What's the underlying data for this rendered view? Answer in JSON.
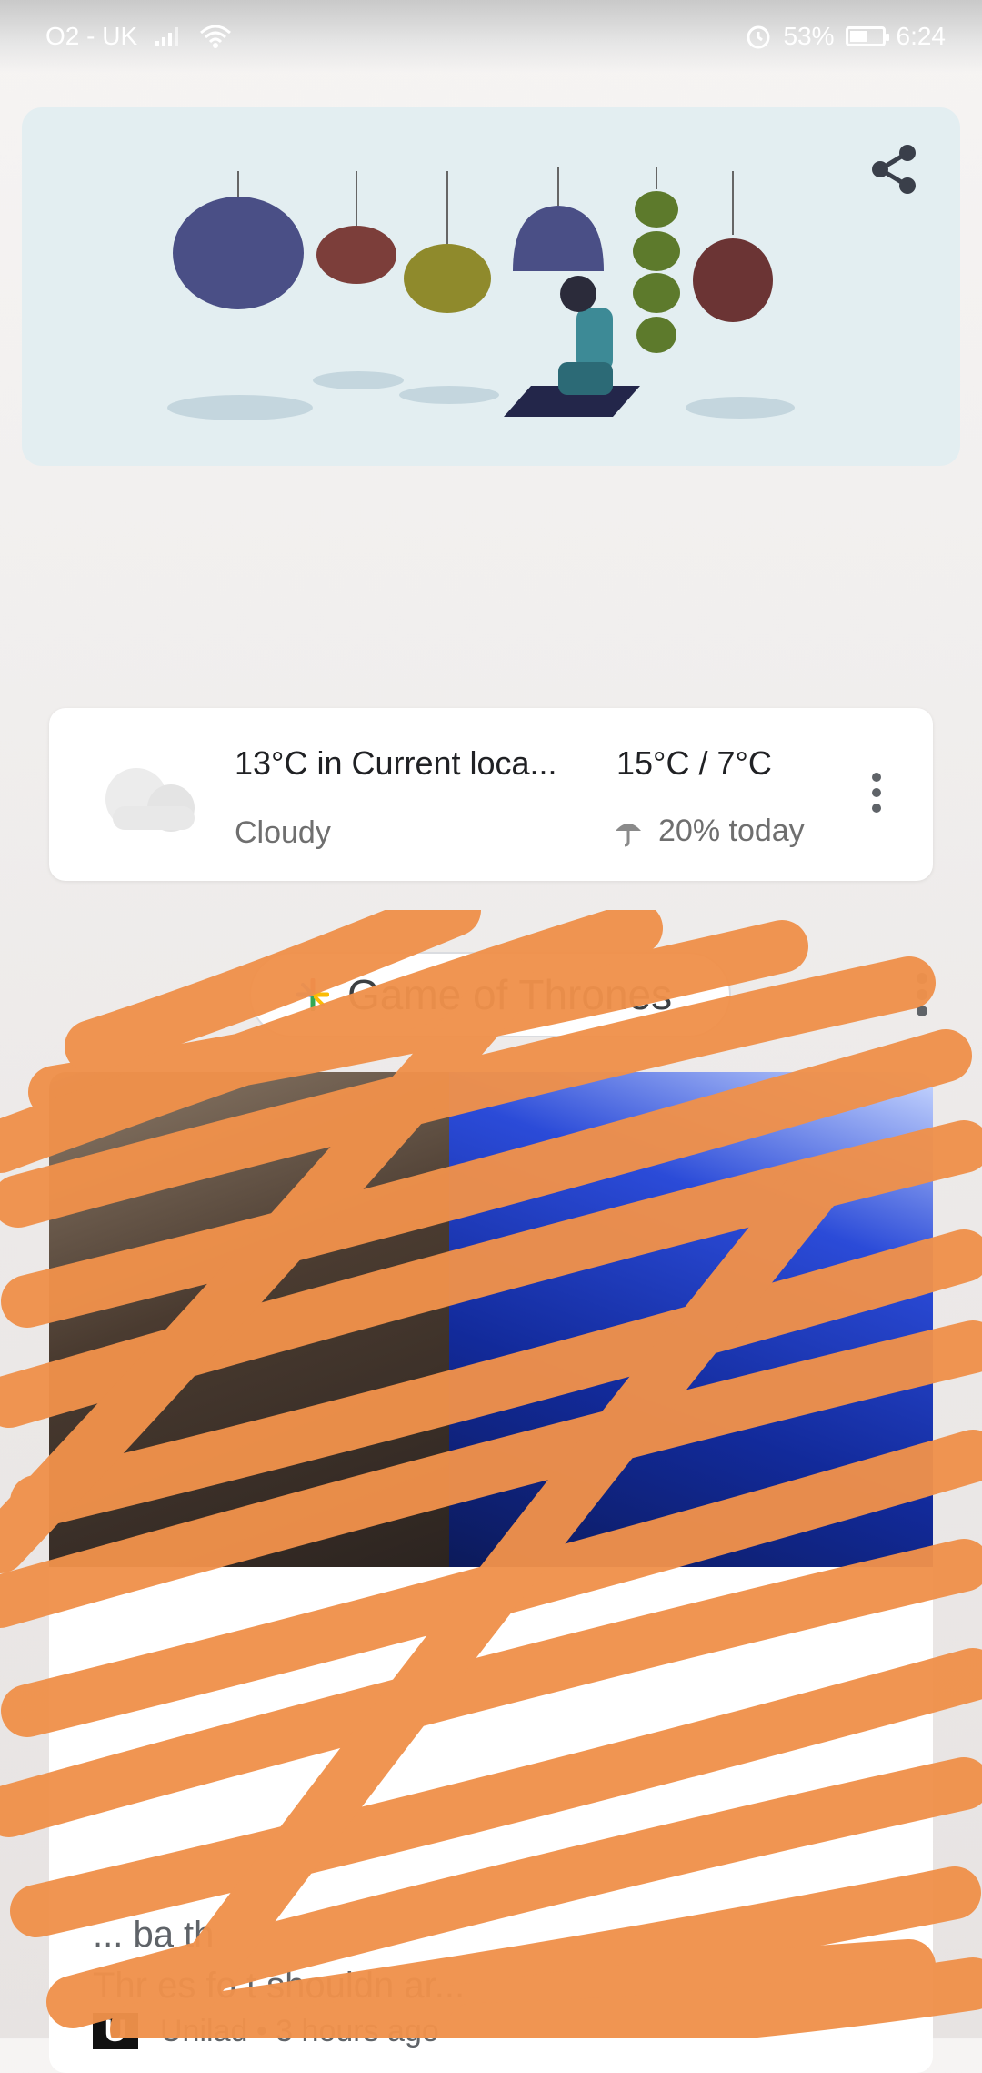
{
  "status_bar": {
    "carrier": "O2 - UK",
    "battery": "53%",
    "battery_fraction": 0.53,
    "time": "6:24"
  },
  "weather": {
    "temp_location": "13°C in Current loca...",
    "condition": "Cloudy",
    "range": "15°C / 7°C",
    "rain": "20% today"
  },
  "topic": {
    "label": "Game of Thrones"
  },
  "article": {
    "snippet": "... ba        th                                          ",
    "snippet2": "Thr   es fo                  t shouldn    ar...",
    "source": "Unilad • 3 hours ago"
  },
  "colors": {
    "scribble": "#f0914b",
    "doodle_bg": "#e3eef1"
  }
}
